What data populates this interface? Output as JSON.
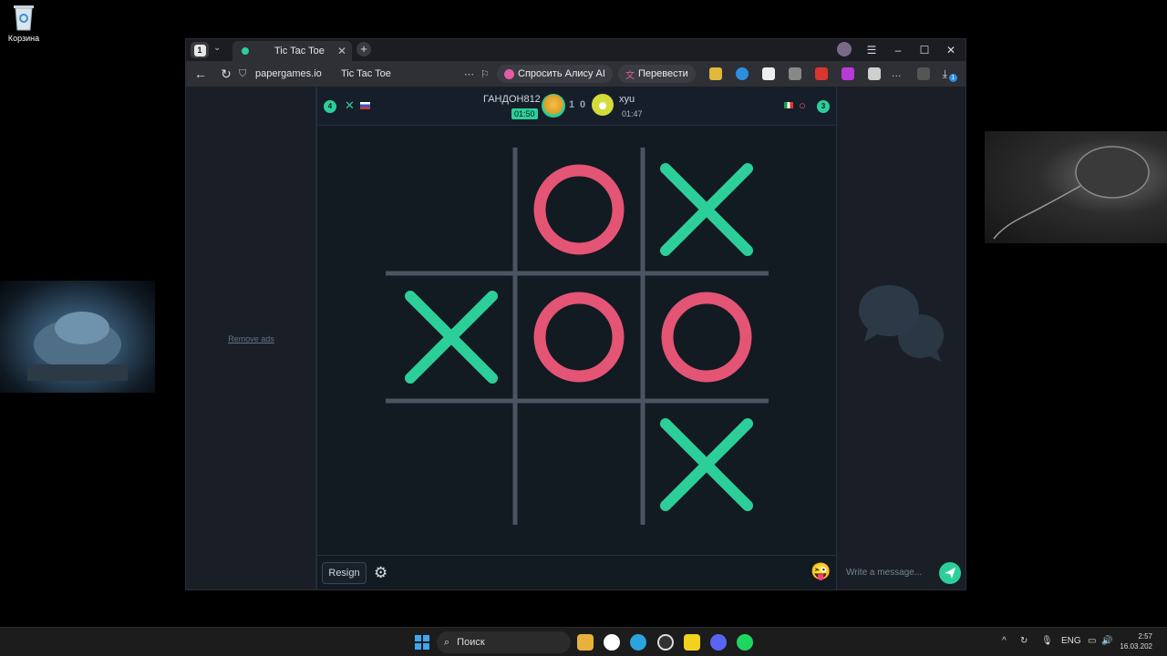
{
  "desktop": {
    "recycle_bin_label": "Корзина"
  },
  "browser": {
    "tab_count": "1",
    "active_tab_title": "Tic Tac Toe",
    "address": "papergames.io",
    "page_title": "Tic Tac Toe",
    "ask_alice_label": "Спросить Алису AI",
    "translate_label": "Перевести",
    "downloads_badge": "1"
  },
  "page": {
    "remove_ads": "Remove ads",
    "player1": {
      "name": "ГАНДОН812",
      "timer": "01:50",
      "badge": "4",
      "mark": "✕",
      "score": "1"
    },
    "player2": {
      "name": "xyu",
      "timer": "01:47",
      "badge": "3",
      "mark": "○",
      "score": "0"
    },
    "board": [
      [
        "",
        "O",
        "X"
      ],
      [
        "X",
        "O",
        "O"
      ],
      [
        "",
        "",
        "X"
      ]
    ],
    "resign_label": "Resign",
    "chat_placeholder": "Write a message...",
    "colors": {
      "x": "#2ccf9a",
      "o": "#e35475",
      "grid": "#4a5561"
    }
  },
  "taskbar": {
    "search_label": "Поиск",
    "lang": "ENG",
    "time": "2:57",
    "date": "16.03.202"
  }
}
